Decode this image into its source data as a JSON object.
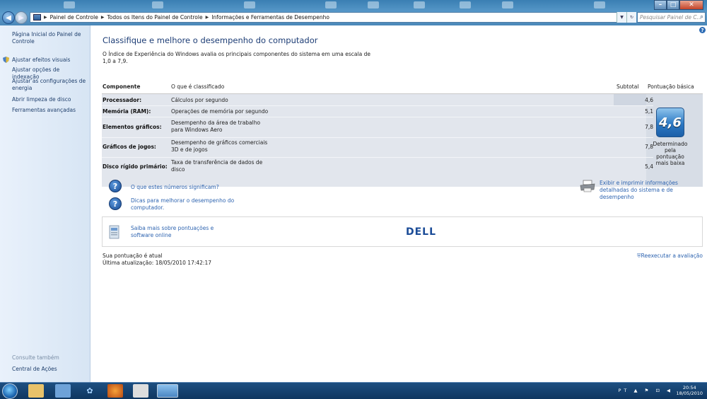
{
  "address_bar": {
    "crumbs": [
      "Painel de Controle",
      "Todos os Itens do Painel de Controle",
      "Informações e Ferramentas de Desempenho"
    ],
    "search_placeholder": "Pesquisar Painel de C..."
  },
  "sidebar": {
    "home": "Página Inicial do Painel de Controle",
    "links": [
      "Ajustar efeitos visuais",
      "Ajustar opções de indexação",
      "Ajustar as configurações de energia",
      "Abrir limpeza de disco",
      "Ferramentas avançadas"
    ],
    "see_also_title": "Consulte também",
    "see_also_links": [
      "Central de Ações"
    ]
  },
  "main": {
    "title": "Classifique e melhore o desempenho do computador",
    "description": "O Índice de Experiência do Windows avalia os principais componentes do sistema em uma escala de 1,0 a 7,9.",
    "table": {
      "headers": {
        "component": "Componente",
        "rated": "O que é classificado",
        "subtotal": "Subtotal",
        "base": "Pontuação básica"
      },
      "rows": [
        {
          "component": "Processador:",
          "rated": "Cálculos por segundo",
          "subtotal": "4,6"
        },
        {
          "component": "Memória (RAM):",
          "rated": "Operações de memória por segundo",
          "subtotal": "5,1"
        },
        {
          "component": "Elementos gráficos:",
          "rated": "Desempenho da área de trabalho para Windows Aero",
          "subtotal": "7,8"
        },
        {
          "component": "Gráficos de jogos:",
          "rated": "Desempenho de gráficos comerciais 3D e de jogos",
          "subtotal": "7,8"
        },
        {
          "component": "Disco rígido primário:",
          "rated": "Taxa de transferência de dados de disco",
          "subtotal": "5,4"
        }
      ],
      "base_score": "4,6",
      "base_caption": "Determinado pela pontuação mais baixa"
    },
    "help_links": [
      "O que estes números significam?",
      "Dicas para melhorar o desempenho do computador."
    ],
    "print_link": "Exibir e imprimir informações detalhadas do sistema e de desempenho",
    "learn_more": "Saiba mais sobre pontuações e software online",
    "brand": "DELL",
    "status_line1": "Sua pontuação é atual",
    "status_line2": "Última atualização: 18/05/2010 17:42:17",
    "rerun": "Reexecutar a avaliação"
  },
  "taskbar": {
    "lang": "PT",
    "time": "20:54",
    "date": "18/05/2010"
  },
  "colors": {
    "link": "#2e64b0",
    "title": "#1e3e76",
    "badge": "#2c79c4"
  }
}
